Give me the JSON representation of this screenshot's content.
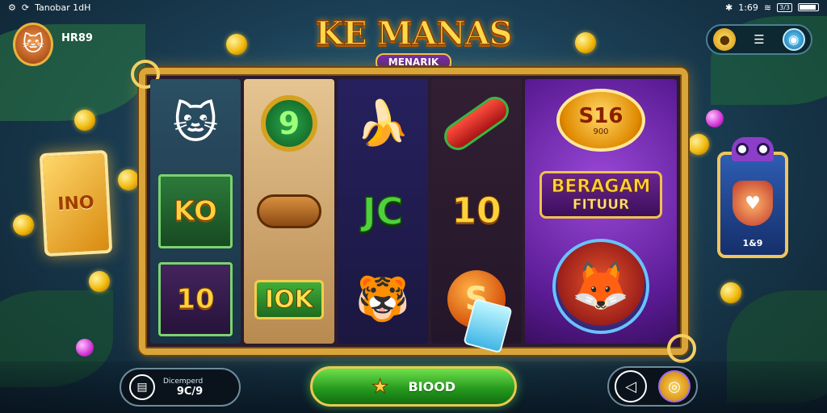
{
  "statusbar": {
    "left_text": "Tanobar 1dH",
    "time": "1:69",
    "battery_label": "3/3"
  },
  "profile": {
    "username": "HR89",
    "avatar_icon": "cat-avatar-icon"
  },
  "logo": {
    "title": "KE MANAS",
    "subtitle": "MENARIK"
  },
  "topbar": {
    "icons": [
      "coins-icon",
      "menu-icon",
      "settings-icon"
    ]
  },
  "side_left": {
    "label": "INO"
  },
  "side_right": {
    "label": "1&9"
  },
  "reels": {
    "col1": [
      "cat-hero-symbol",
      "KO",
      "10"
    ],
    "col2": [
      "9",
      "log-symbol",
      "IOK"
    ],
    "col3": [
      "banana-symbol",
      "JC",
      "panther-symbol"
    ],
    "col4": [
      "rocket-symbol",
      "10",
      "S"
    ],
    "feature": {
      "coin_big": "S16",
      "coin_small": "900",
      "banner_line1": "BERAGAM",
      "banner_line2": "FITUUR"
    }
  },
  "bottom": {
    "bet_label": "Dicemperd",
    "bet_value": "9C/9",
    "spin_label": "BIOOD"
  },
  "colors": {
    "accent_gold": "#d9a43a",
    "spin_green": "#23961c",
    "panel_purple": "#5a1b94"
  }
}
